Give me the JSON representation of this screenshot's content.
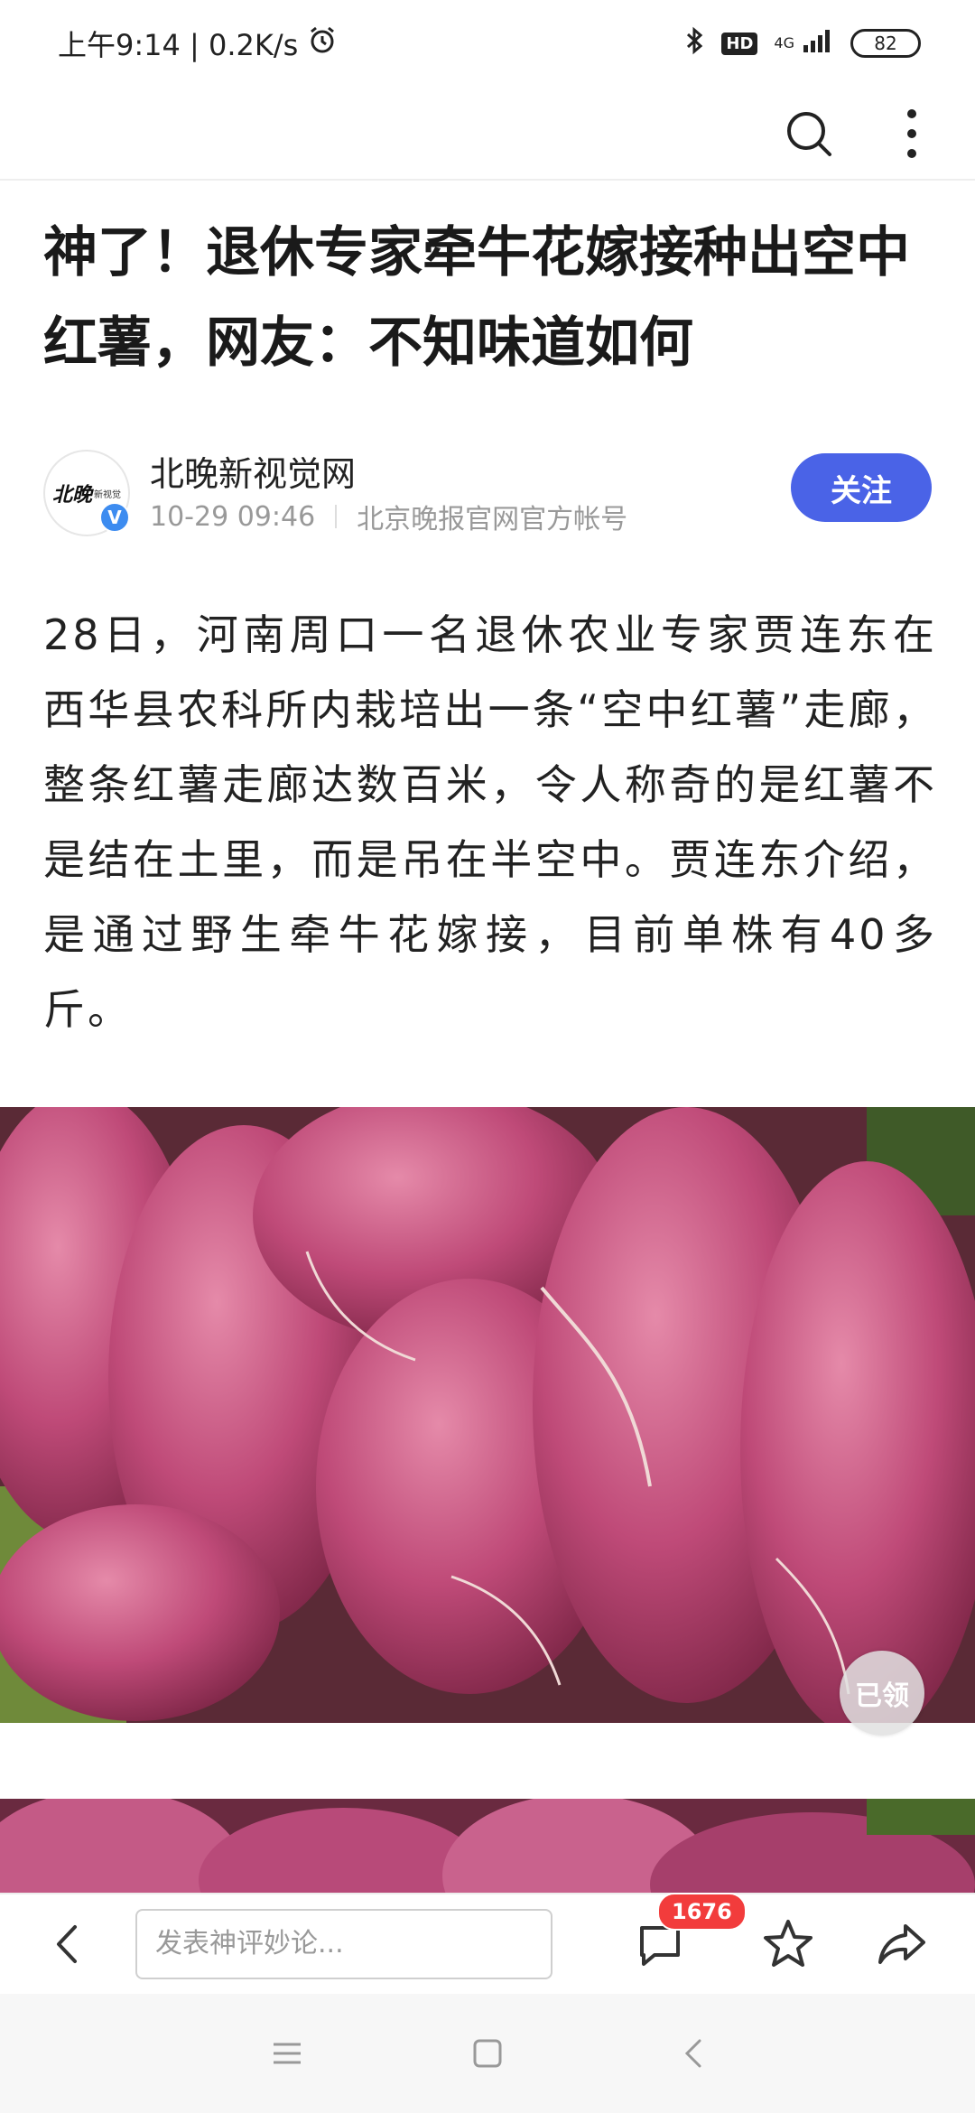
{
  "status_bar": {
    "time_speed": "上午9:14 | 0.2K/s",
    "hd_label": "HD",
    "network_label": "4G",
    "battery": "82",
    "icons": [
      "alarm-icon",
      "bluetooth-icon",
      "signal-icon",
      "battery-icon"
    ]
  },
  "app_bar": {
    "icons": [
      "search-icon",
      "more-icon"
    ]
  },
  "article": {
    "title": "神了！退休专家牵牛花嫁接种出空中红薯，网友：不知味道如何",
    "author": {
      "name": "北晚新视觉网",
      "logo_text": "北晚",
      "logo_sub": "新视觉",
      "verified_mark": "V",
      "date": "10-29 09:46",
      "account_desc": "北京晚报官网官方帐号",
      "follow_label": "关注"
    },
    "body": "28日，河南周口一名退休农业专家贾连东在西华县农科所内栽培出一条“空中红薯”走廊，整条红薯走廊达数百米，令人称奇的是红薯不是结在土里，而是吊在半空中。贾连东介绍，是通过野生牵牛花嫁接，目前单株有40多斤。",
    "claimed_badge": "已领"
  },
  "bottom_bar": {
    "comment_placeholder": "发表神评妙论...",
    "comment_count": "1676",
    "icons": [
      "back-icon",
      "comment-icon",
      "star-icon",
      "share-icon"
    ]
  },
  "nav_bar": {
    "icons": [
      "menu-icon",
      "home-icon",
      "back-nav-icon"
    ]
  },
  "colors": {
    "accent": "#4a63e7",
    "badge_red": "#f23c3c",
    "verified_blue": "#3d8cf0"
  }
}
